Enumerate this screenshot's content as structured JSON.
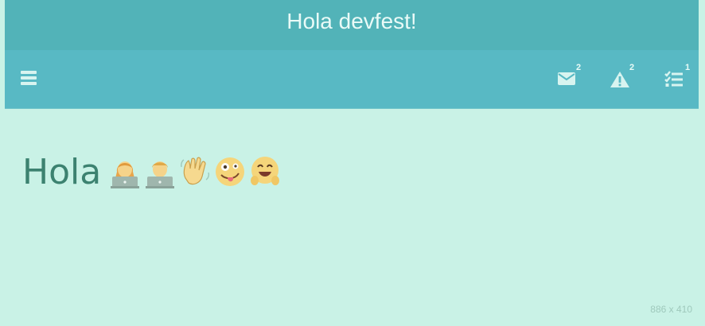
{
  "app": {
    "title": "Hola devfest!"
  },
  "navbar": {
    "menu_icon": "hamburger-menu-icon",
    "items": [
      {
        "icon": "envelope-icon",
        "badge": "2"
      },
      {
        "icon": "warning-icon",
        "badge": "2"
      },
      {
        "icon": "tasks-icon",
        "badge": "1"
      }
    ]
  },
  "content": {
    "greeting": "Hola",
    "emojis": [
      "woman-technologist",
      "man-technologist",
      "waving-hand",
      "zany-face",
      "hugging-face"
    ]
  },
  "watermark": "886 x 410",
  "colors": {
    "titlebar": "#52b3b8",
    "navbar": "#58b9c4",
    "background": "#c9f2e6",
    "greeting_text": "#3c8270"
  }
}
